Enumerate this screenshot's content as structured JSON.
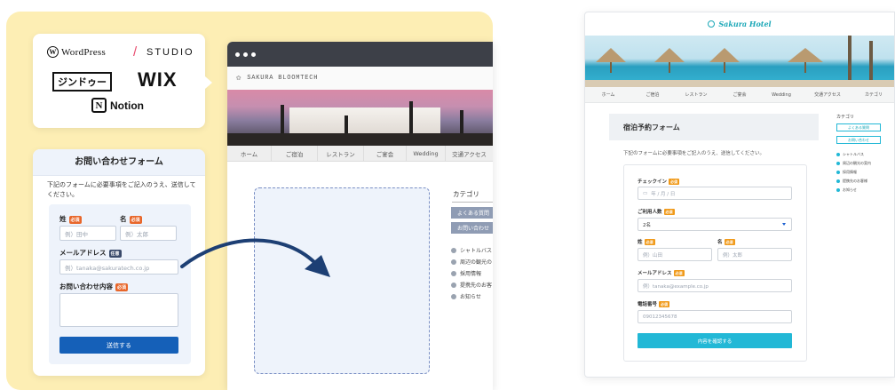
{
  "logos": {
    "wordpress": "WordPress",
    "slash": "/",
    "studio": "STUDIO",
    "jimdo": "ジンドゥー",
    "wix": "WIX",
    "notion": "Notion"
  },
  "contact_form": {
    "title": "お問い合わせフォーム",
    "description": "下記のフォームに必要事項をご記入のうえ、送信してください。",
    "last_name_label": "姓",
    "first_name_label": "名",
    "required_badge": "必須",
    "optional_badge": "任意",
    "last_name_placeholder": "例）田中",
    "first_name_placeholder": "例）太郎",
    "email_label": "メールアドレス",
    "email_placeholder": "例）tanaka@sakuratech.co.jp",
    "message_label": "お問い合わせ内容",
    "submit_label": "送信する"
  },
  "browser_mock": {
    "site_name": "SAKURA BLOOMTECH",
    "nav": [
      "ホーム",
      "ご宿泊",
      "レストラン",
      "ご宴会",
      "Wedding",
      "交通アクセス"
    ],
    "category_title": "カテゴリ",
    "category_buttons": [
      "よくある質問",
      "お問い合わせ"
    ],
    "category_links": [
      "シャトルバス",
      "周辺の観光の",
      "採用情報",
      "提携先のお客",
      "お知らせ"
    ]
  },
  "hotel_mock": {
    "brand": "Sakura Hotel",
    "nav": [
      "ホーム",
      "ご宿泊",
      "レストラン",
      "ご宴会",
      "Wedding",
      "交通アクセス",
      "カテゴリ"
    ],
    "form_title": "宿泊予約フォーム",
    "description": "下記のフォームに必要事項をご記入のうえ、送信してください。",
    "checkin_label": "チェックイン",
    "checkin_placeholder": "年 / 月 / 日",
    "guests_label": "ご利用人数",
    "guests_value": "2名",
    "last_name_label": "姓",
    "first_name_label": "名",
    "last_name_placeholder": "例）山田",
    "first_name_placeholder": "例）太郎",
    "email_label": "メールアドレス",
    "email_placeholder": "例）tanaka@example.co.jp",
    "phone_label": "電話番号",
    "phone_placeholder": "09012345678",
    "required_badge": "必須",
    "submit_label": "内容を確認する",
    "category_title": "カテゴリ",
    "category_buttons": [
      "よくある質問",
      "お問い合わせ"
    ],
    "category_links": [
      "シャトルバス",
      "周辺の観光の案内",
      "採用情報",
      "提携先のお客様",
      "お知らせ"
    ]
  },
  "colors": {
    "panel_bg": "#fdeeb4",
    "form_blue": "#1560b8",
    "arrow_navy": "#1d3f74",
    "hotel_accent": "#22b8d6"
  }
}
